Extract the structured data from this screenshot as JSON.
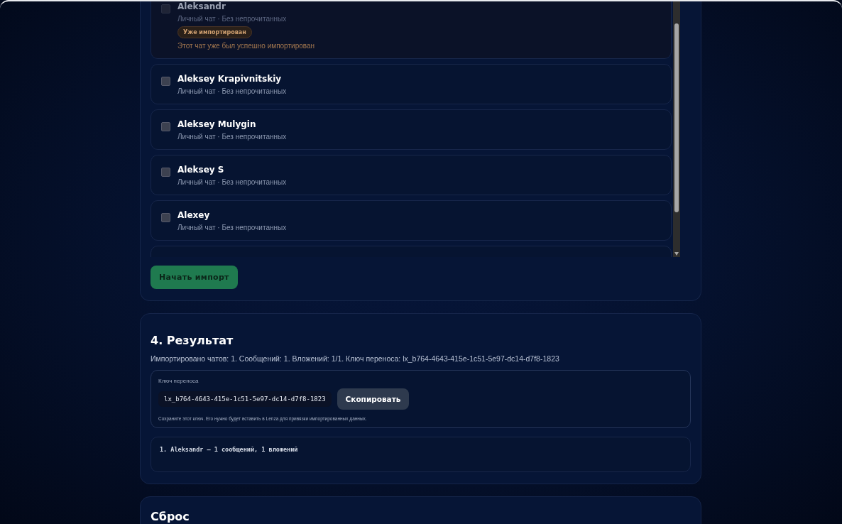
{
  "import_card": {
    "chats": [
      {
        "name": "Aleksandr",
        "subtitle": "Личный чат · Без непрочитанных",
        "checked": false,
        "disabled": true,
        "badge": "Уже импортирован",
        "note": "Этот чат уже был успешно импортирован"
      },
      {
        "name": "Aleksey Krapivnitskiy",
        "subtitle": "Личный чат · Без непрочитанных",
        "checked": false,
        "disabled": false
      },
      {
        "name": "Aleksey Mulygin",
        "subtitle": "Личный чат · Без непрочитанных",
        "checked": false,
        "disabled": false
      },
      {
        "name": "Aleksey S",
        "subtitle": "Личный чат · Без непрочитанных",
        "checked": false,
        "disabled": false
      },
      {
        "name": "Alexey",
        "subtitle": "Личный чат · Без непрочитанных",
        "checked": false,
        "disabled": false
      }
    ],
    "start_button": "Начать импорт"
  },
  "result_card": {
    "title": "4. Результат",
    "summary": "Импортировано чатов: 1. Сообщений: 1. Вложений: 1/1. Ключ переноса: lx_b764-4643-415e-1c51-5e97-dc14-d7f8-1823",
    "key_label": "Ключ переноса",
    "key_value": "lx_b764-4643-415e-1c51-5e97-dc14-d7f8-1823",
    "copy_button": "Скопировать",
    "key_hint": "Сохраните этот ключ. Его нужно будет вставить в Lenza для привязки импортированных данных.",
    "log": [
      "1. Aleksandr — 1 сообщений, 1 вложений"
    ]
  },
  "reset_card": {
    "title": "Сброс"
  }
}
